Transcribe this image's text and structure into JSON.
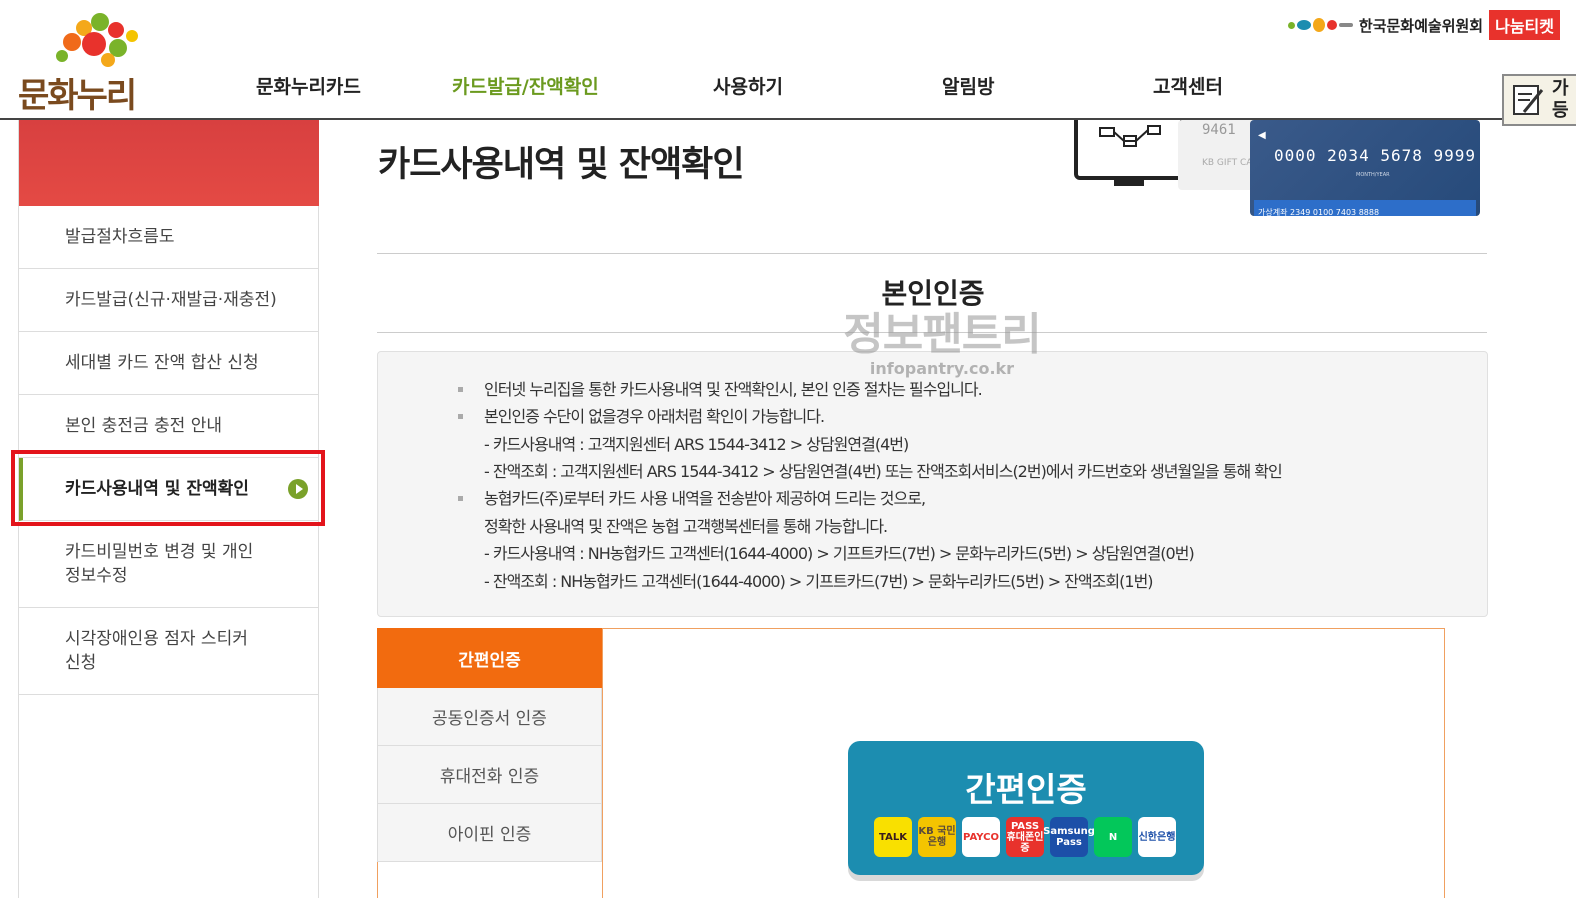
{
  "header": {
    "logo_text": "문화누리",
    "nav": [
      {
        "label": "문화누리카드",
        "active": false
      },
      {
        "label": "카드발급/잔액확인",
        "active": true
      },
      {
        "label": "사용하기",
        "active": false
      },
      {
        "label": "알림방",
        "active": false
      },
      {
        "label": "고객센터",
        "active": false
      }
    ],
    "arts_council": "한국문화예술위원회",
    "ticket_label": "나눔티켓",
    "side_widget_text": "가\n등"
  },
  "sidebar": {
    "items": [
      {
        "label": "발급절차흐름도"
      },
      {
        "label": "카드발급(신규·재발급·재충전)"
      },
      {
        "label": "세대별 카드 잔액 합산 신청"
      },
      {
        "label": "본인 충전금 충전 안내"
      },
      {
        "label": "카드사용내역 및 잔액확인",
        "active": true
      },
      {
        "label": "카드비밀번호 변경 및 개인 정보수정"
      },
      {
        "label": "시각장애인용 점자 스티커 신청"
      }
    ]
  },
  "main": {
    "page_title": "카드사용내역 및 잔액확인",
    "card_illustration": {
      "white_card_number": "9461",
      "white_card_label": "KB GIFT CA",
      "blue_card_number": "0000 2034 5678 9999",
      "blue_card_expiry": "MONTH/YEAR",
      "blue_card_account": "가상계좌  2349 0100 7403 8888"
    },
    "section_title": "본인인증",
    "watermark_main": "정보팬트리",
    "watermark_sub": "infopantry.co.kr",
    "info": {
      "lines": [
        {
          "text": "인터넷 누리집을 통한 카드사용내역 및 잔액확인시, 본인 인증 절차는 필수입니다.",
          "bullet": true
        },
        {
          "text": "본인인증 수단이 없을경우 아래처럼 확인이 가능합니다.",
          "bullet": true
        },
        {
          "text": "- 카드사용내역 : 고객지원센터 ARS 1544-3412 > 상담원연결(4번)",
          "bullet": false
        },
        {
          "text": "- 잔액조회 : 고객지원센터 ARS 1544-3412 > 상담원연결(4번) 또는 잔액조회서비스(2번)에서 카드번호와 생년월일을 통해 확인",
          "bullet": false
        },
        {
          "text": "농협카드(주)로부터 카드 사용 내역을 전송받아 제공하여 드리는 것으로,",
          "bullet": true
        },
        {
          "text": "정확한 사용내역 및 잔액은 농협 고객행복센터를 통해 가능합니다.",
          "bullet": false
        },
        {
          "text": "- 카드사용내역 : NH농협카드 고객센터(1644-4000) > 기프트카드(7번) > 문화누리카드(5번) > 상담원연결(0번)",
          "bullet": false
        },
        {
          "text": "- 잔액조회 : NH농협카드 고객센터(1644-4000) > 기프트카드(7번) > 문화누리카드(5번) > 잔액조회(1번)",
          "bullet": false
        }
      ]
    },
    "auth": {
      "tabs": [
        {
          "label": "간편인증",
          "active": true
        },
        {
          "label": "공동인증서 인증",
          "active": false
        },
        {
          "label": "휴대전화 인증",
          "active": false
        },
        {
          "label": "아이핀 인증",
          "active": false
        }
      ],
      "easy_title": "간편인증",
      "providers": [
        {
          "name": "kakaotalk-icon",
          "label": "TALK",
          "bg": "#f9e000",
          "fg": "#3a1d1d"
        },
        {
          "name": "kb-icon",
          "label": "KB 국민은행",
          "bg": "#f4c400",
          "fg": "#5a4a3a"
        },
        {
          "name": "payco-icon",
          "label": "PAYCO",
          "bg": "#ffffff",
          "fg": "#e8322c"
        },
        {
          "name": "pass-icon",
          "label": "PASS 휴대폰인증",
          "bg": "#e8322c",
          "fg": "#ffffff"
        },
        {
          "name": "samsung-pass-icon",
          "label": "Samsung Pass",
          "bg": "#1c4fa8",
          "fg": "#ffffff"
        },
        {
          "name": "naver-icon",
          "label": "N",
          "bg": "#03c75a",
          "fg": "#ffffff"
        },
        {
          "name": "shinhan-icon",
          "label": "신한은행",
          "bg": "#ffffff",
          "fg": "#1c4fa8"
        }
      ]
    }
  },
  "colors": {
    "nav_active": "#6b9a1f",
    "tab_active": "#f26b0f",
    "easy_panel": "#1c8db0",
    "highlight": "#e3141b",
    "side_banner": "#e04444"
  }
}
